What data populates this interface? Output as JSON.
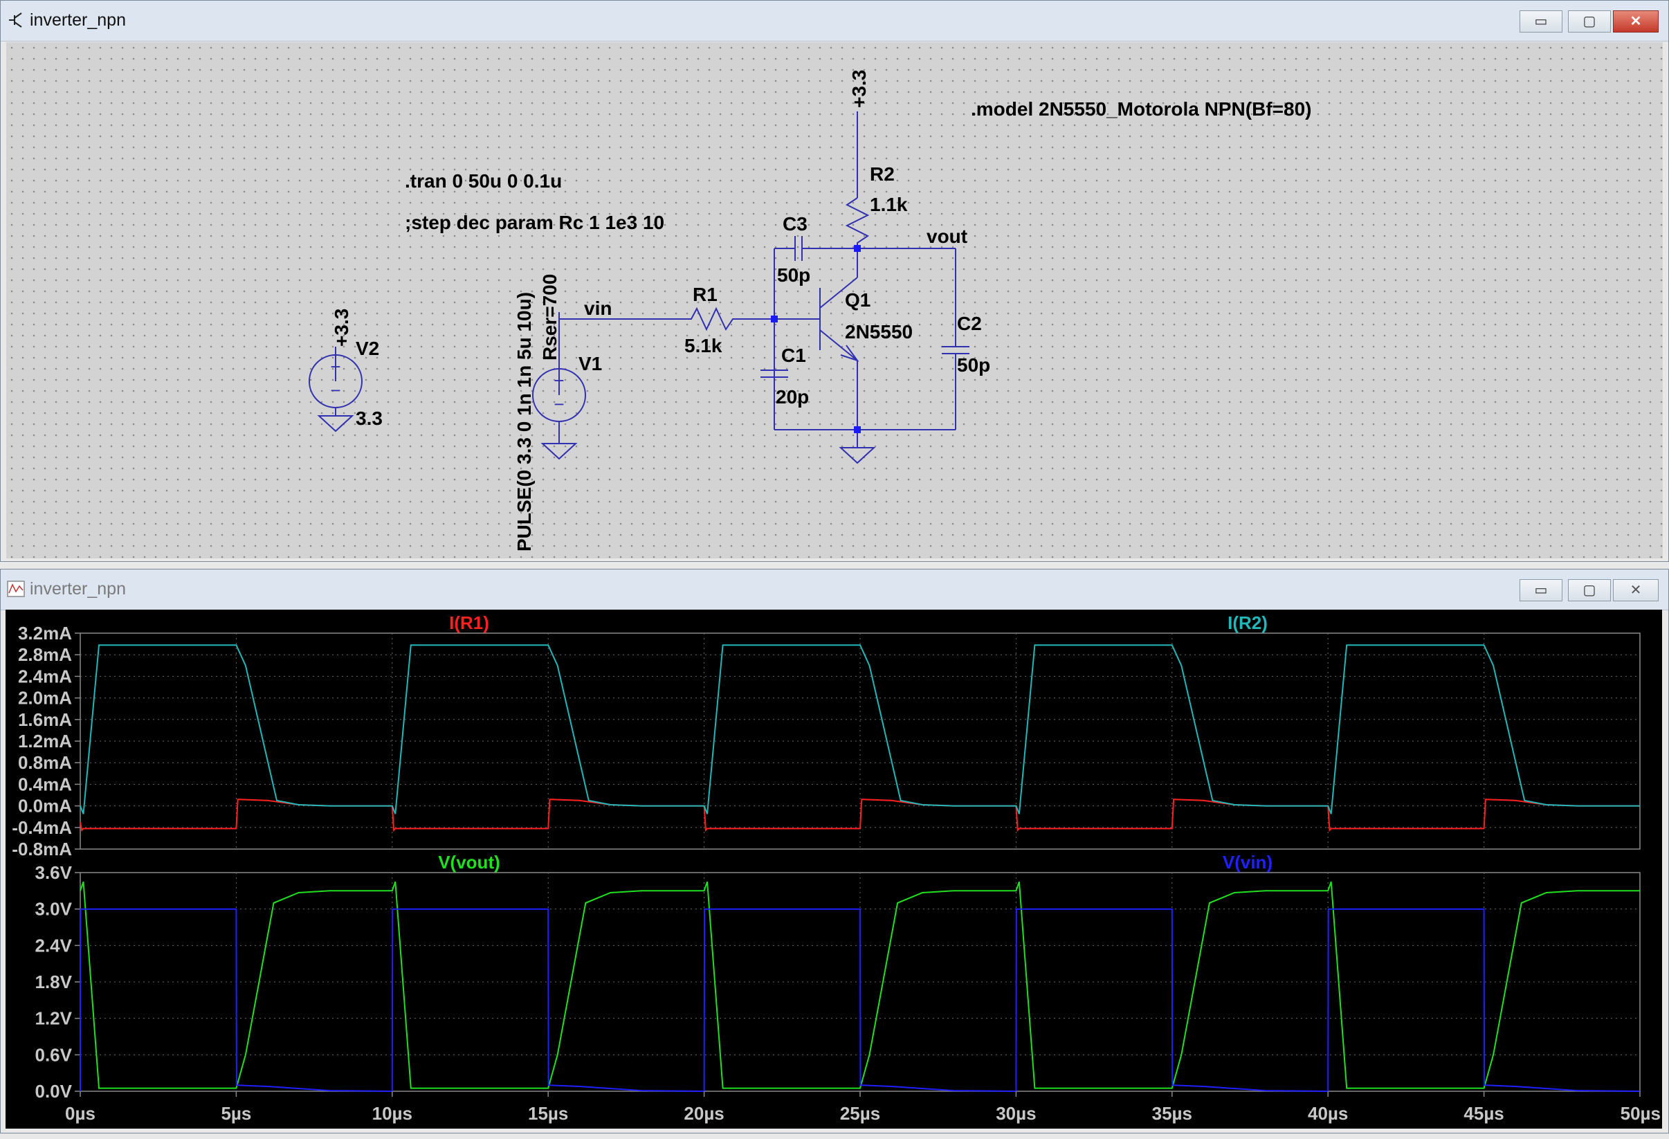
{
  "schematic_window": {
    "title": "inverter_npn",
    "buttons": {
      "minimize": "▭",
      "restore": "▢",
      "close": "✕"
    }
  },
  "schematic": {
    "directives": {
      "tran": ".tran 0 50u 0 0.1u",
      "step": ";step dec param Rc 1 1e3 10",
      "model": ".model 2N5550_Motorola NPN(Bf=80)"
    },
    "components": {
      "V2": {
        "name": "V2",
        "value": "3.3",
        "net": "+3.3"
      },
      "V1": {
        "name": "V1",
        "value": "PULSE(0 3.3 0 1n 1n 5u 10u)",
        "rser": "Rser=700"
      },
      "R1": {
        "name": "R1",
        "value": "5.1k"
      },
      "R2": {
        "name": "R2",
        "value": "1.1k"
      },
      "C1": {
        "name": "C1",
        "value": "20p"
      },
      "C2": {
        "name": "C2",
        "value": "50p"
      },
      "C3": {
        "name": "C3",
        "value": "50p"
      },
      "Q1": {
        "name": "Q1",
        "value": "2N5550"
      }
    },
    "nets": {
      "vin": "vin",
      "vout": "vout",
      "supply": "+3.3"
    }
  },
  "waveform_window": {
    "title": "inverter_npn",
    "buttons": {
      "minimize": "▭",
      "restore": "▢",
      "close": "✕"
    }
  },
  "chart_data": [
    {
      "type": "line",
      "pane": "top",
      "ylim": [
        -0.8,
        3.2
      ],
      "yticks": [
        "3.2mA",
        "2.8mA",
        "2.4mA",
        "2.0mA",
        "1.6mA",
        "1.2mA",
        "0.8mA",
        "0.4mA",
        "0.0mA",
        "-0.4mA",
        "-0.8mA"
      ],
      "series": [
        {
          "name": "I(R1)",
          "color": "#ff2020",
          "x": [
            0,
            0.05,
            0.1,
            5,
            5.05,
            6,
            7,
            8,
            10,
            10.05,
            10.1,
            15,
            15.05,
            16,
            17,
            18,
            20,
            20.05,
            20.1,
            25,
            25.05,
            26,
            27,
            28,
            30,
            30.05,
            30.1,
            35,
            35.05,
            36,
            37,
            38,
            40,
            40.05,
            40.1,
            45,
            45.05,
            46,
            47,
            48,
            50
          ],
          "y": [
            -0.3,
            -0.45,
            -0.42,
            -0.42,
            0.12,
            0.1,
            0.02,
            0.0,
            0.0,
            -0.45,
            -0.42,
            -0.42,
            0.12,
            0.1,
            0.02,
            0.0,
            0.0,
            -0.45,
            -0.42,
            -0.42,
            0.12,
            0.1,
            0.02,
            0.0,
            0.0,
            -0.45,
            -0.42,
            -0.42,
            0.12,
            0.1,
            0.02,
            0.0,
            0.0,
            -0.45,
            -0.42,
            -0.42,
            0.12,
            0.1,
            0.02,
            0.0,
            0.0
          ]
        },
        {
          "name": "I(R2)",
          "color": "#20b8b8",
          "x": [
            0,
            0.1,
            0.6,
            5,
            5.3,
            6.3,
            7,
            8,
            10,
            10.1,
            10.6,
            15,
            15.3,
            16.3,
            17,
            18,
            20,
            20.1,
            20.6,
            25,
            25.3,
            26.3,
            27,
            28,
            30,
            30.1,
            30.6,
            35,
            35.3,
            36.3,
            37,
            38,
            40,
            40.1,
            40.6,
            45,
            45.3,
            46.3,
            47,
            48,
            50
          ],
          "y": [
            0,
            -0.15,
            2.98,
            2.98,
            2.6,
            0.1,
            0.02,
            0.0,
            0.0,
            -0.15,
            2.98,
            2.98,
            2.6,
            0.1,
            0.02,
            0.0,
            0.0,
            -0.15,
            2.98,
            2.98,
            2.6,
            0.1,
            0.02,
            0.0,
            0.0,
            -0.15,
            2.98,
            2.98,
            2.6,
            0.1,
            0.02,
            0.0,
            0.0,
            -0.15,
            2.98,
            2.98,
            2.6,
            0.1,
            0.02,
            0.0,
            0.0
          ]
        }
      ]
    },
    {
      "type": "line",
      "pane": "bottom",
      "ylim": [
        0,
        3.6
      ],
      "yticks": [
        "3.6V",
        "3.0V",
        "2.4V",
        "1.8V",
        "1.2V",
        "0.6V",
        "0.0V"
      ],
      "xlim": [
        0,
        50
      ],
      "xticks": [
        "0µs",
        "5µs",
        "10µs",
        "15µs",
        "20µs",
        "25µs",
        "30µs",
        "35µs",
        "40µs",
        "45µs",
        "50µs"
      ],
      "series": [
        {
          "name": "V(vout)",
          "color": "#20e020",
          "x": [
            0,
            0.1,
            0.6,
            5,
            5.3,
            6.2,
            7,
            8,
            10,
            10.1,
            10.6,
            15,
            15.3,
            16.2,
            17,
            18,
            20,
            20.1,
            20.6,
            25,
            25.3,
            26.2,
            27,
            28,
            30,
            30.1,
            30.6,
            35,
            35.3,
            36.2,
            37,
            38,
            40,
            40.1,
            40.6,
            45,
            45.3,
            46.2,
            47,
            48,
            50
          ],
          "y": [
            3.3,
            3.45,
            0.05,
            0.05,
            0.6,
            3.1,
            3.27,
            3.3,
            3.3,
            3.45,
            0.05,
            0.05,
            0.6,
            3.1,
            3.27,
            3.3,
            3.3,
            3.45,
            0.05,
            0.05,
            0.6,
            3.1,
            3.27,
            3.3,
            3.3,
            3.45,
            0.05,
            0.05,
            0.6,
            3.1,
            3.27,
            3.3,
            3.3,
            3.45,
            0.05,
            0.05,
            0.6,
            3.1,
            3.27,
            3.3,
            3.3
          ]
        },
        {
          "name": "V(vin)",
          "color": "#2020ff",
          "x": [
            0,
            0.01,
            5,
            5.01,
            6,
            8,
            10,
            10.01,
            15,
            15.01,
            16,
            18,
            20,
            20.01,
            25,
            25.01,
            26,
            28,
            30,
            30.01,
            35,
            35.01,
            36,
            38,
            40,
            40.01,
            45,
            45.01,
            46,
            48,
            50
          ],
          "y": [
            0,
            3.0,
            3.0,
            0.1,
            0.08,
            0.01,
            0.0,
            3.0,
            3.0,
            0.1,
            0.08,
            0.01,
            0.0,
            3.0,
            3.0,
            0.1,
            0.08,
            0.01,
            0.0,
            3.0,
            3.0,
            0.1,
            0.08,
            0.01,
            0.0,
            3.0,
            3.0,
            0.1,
            0.08,
            0.01,
            0.0
          ]
        }
      ]
    }
  ]
}
